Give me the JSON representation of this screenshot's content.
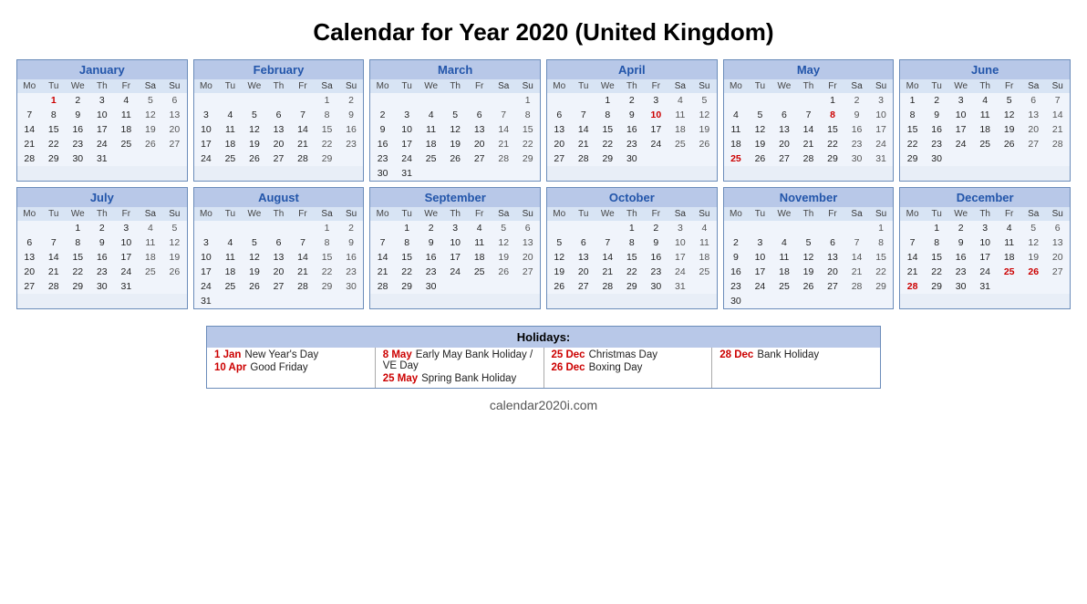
{
  "title": "Calendar for Year 2020 (United Kingdom)",
  "months": [
    {
      "name": "January",
      "startDay": 2,
      "days": 31,
      "holidays": [
        1
      ],
      "weekendCols": [
        6,
        7
      ]
    },
    {
      "name": "February",
      "startDay": 6,
      "days": 29,
      "holidays": [],
      "weekendCols": [
        6,
        7
      ]
    },
    {
      "name": "March",
      "startDay": 7,
      "days": 31,
      "holidays": [],
      "weekendCols": [
        6,
        7
      ]
    },
    {
      "name": "April",
      "startDay": 3,
      "days": 30,
      "holidays": [
        10
      ],
      "weekendCols": [
        6,
        7
      ]
    },
    {
      "name": "May",
      "startDay": 5,
      "days": 31,
      "holidays": [
        8,
        25
      ],
      "weekendCols": [
        6,
        7
      ]
    },
    {
      "name": "June",
      "startDay": 1,
      "days": 30,
      "holidays": [],
      "weekendCols": [
        6,
        7
      ]
    },
    {
      "name": "July",
      "startDay": 3,
      "days": 31,
      "holidays": [],
      "weekendCols": [
        6,
        7
      ]
    },
    {
      "name": "August",
      "startDay": 6,
      "days": 31,
      "holidays": [],
      "weekendCols": [
        6,
        7
      ]
    },
    {
      "name": "September",
      "startDay": 2,
      "days": 30,
      "holidays": [],
      "weekendCols": [
        6,
        7
      ]
    },
    {
      "name": "October",
      "startDay": 4,
      "days": 31,
      "holidays": [],
      "weekendCols": [
        6,
        7
      ]
    },
    {
      "name": "November",
      "startDay": 7,
      "days": 30,
      "holidays": [],
      "weekendCols": [
        6,
        7
      ]
    },
    {
      "name": "December",
      "startDay": 2,
      "days": 31,
      "holidays": [
        25,
        28
      ],
      "weekendCols": [
        6,
        7
      ]
    }
  ],
  "dayHeaders": [
    "Mo",
    "Tu",
    "We",
    "Th",
    "Fr",
    "Sa",
    "Su"
  ],
  "holidays": {
    "col1": [
      {
        "date": "1 Jan",
        "name": "New Year's Day"
      },
      {
        "date": "10 Apr",
        "name": "Good Friday"
      }
    ],
    "col2": [
      {
        "date": "8 May",
        "name": "Early May Bank Holiday / VE Day"
      },
      {
        "date": "25 May",
        "name": "Spring Bank Holiday"
      }
    ],
    "col3": [
      {
        "date": "25 Dec",
        "name": "Christmas Day"
      },
      {
        "date": "26 Dec",
        "name": "Boxing Day"
      }
    ],
    "col4": [
      {
        "date": "28 Dec",
        "name": "Bank Holiday"
      },
      {
        "date": "",
        "name": ""
      }
    ]
  },
  "footer": "calendar2020i.com"
}
